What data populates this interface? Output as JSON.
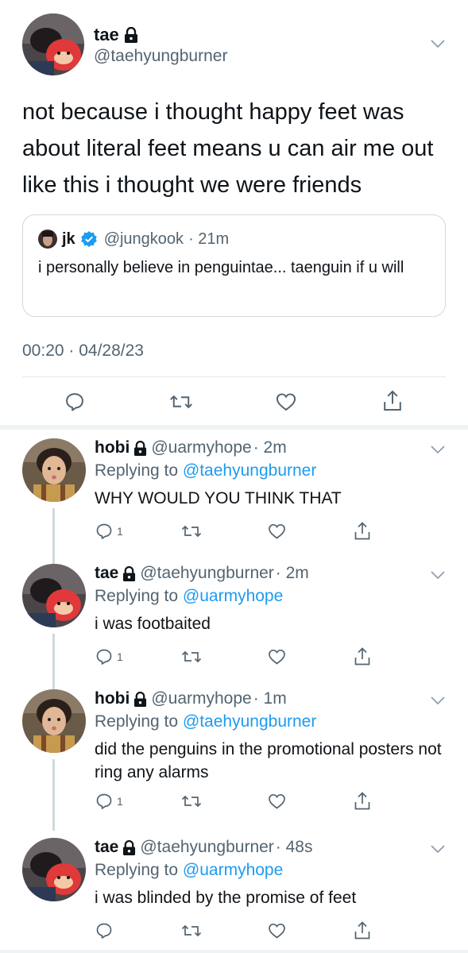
{
  "main_tweet": {
    "name": "tae",
    "handle": "@taehyungburner",
    "text": "not because i thought happy feet was about literal feet means u can air me out like this i thought we were friends",
    "timestamp": "00:20 · 04/28/23",
    "icons": [
      "lock-icon",
      "chevron-down-icon",
      "reply-icon",
      "retweet-icon",
      "like-icon",
      "share-icon"
    ]
  },
  "quote": {
    "name": "jk",
    "handle": "@jungkook",
    "time": "· 21m",
    "text": "i personally believe in penguintae... taenguin if u will",
    "icons": [
      "verified-badge-icon"
    ]
  },
  "replies": [
    {
      "name": "hobi",
      "handle": "@uarmyhope",
      "time": "· 2m",
      "replying_label": "Replying to",
      "replying_to": "@taehyungburner",
      "text": "WHY WOULD YOU THINK THAT",
      "reply_count": "1"
    },
    {
      "name": "tae",
      "handle": "@taehyungburner",
      "time": "· 2m",
      "replying_label": "Replying to",
      "replying_to": "@uarmyhope",
      "text": "i was footbaited",
      "reply_count": "1"
    },
    {
      "name": "hobi",
      "handle": "@uarmyhope",
      "time": "· 1m",
      "replying_label": "Replying to",
      "replying_to": "@taehyungburner",
      "text": "did the penguins in the promotional posters not ring any alarms",
      "reply_count": "1"
    },
    {
      "name": "tae",
      "handle": "@taehyungburner",
      "time": "· 48s",
      "replying_label": "Replying to",
      "replying_to": "@uarmyhope",
      "text": "i was blinded by the promise of feet",
      "reply_count": ""
    }
  ],
  "colors": {
    "link": "#1d9bf0",
    "secondary_text": "#536471",
    "primary_text": "#0f1419",
    "verified": "#1d9bf0",
    "divider": "#e4e8eb"
  }
}
